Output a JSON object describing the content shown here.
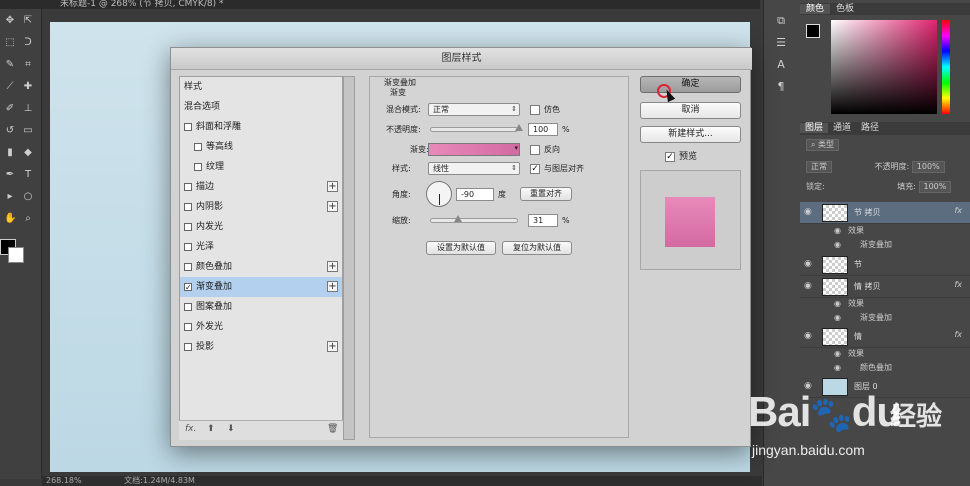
{
  "document_tab": "未标题-1 @ 268% (节 拷贝, CMYK/8) *",
  "status_bar": {
    "zoom": "268.18%",
    "doc_size": "文档:1.24M/4.83M"
  },
  "color_panel": {
    "tabs": [
      "颜色",
      "色板"
    ]
  },
  "layers_panel": {
    "tabs": [
      "图层",
      "通道",
      "路径"
    ],
    "kind_filter": "类型",
    "blend_mode": "正常",
    "opacity_label": "不透明度:",
    "opacity_value": "100%",
    "lock_label": "锁定:",
    "fill_label": "填充:",
    "fill_value": "100%",
    "layers": [
      {
        "name": "节 拷贝",
        "fx": "fx",
        "effects_label": "效果",
        "effect": "渐变叠加"
      },
      {
        "name": "节"
      },
      {
        "name": "情 拷贝",
        "fx": "fx",
        "effects_label": "效果",
        "effect": "渐变叠加"
      },
      {
        "name": "情",
        "fx": "fx",
        "effects_label": "效果",
        "effect": "颜色叠加"
      },
      {
        "name": "图层 0"
      }
    ]
  },
  "dialog": {
    "title": "图层样式",
    "style_list": [
      {
        "label": "样式",
        "checkbox": false,
        "plus": false
      },
      {
        "label": "混合选项",
        "checkbox": false,
        "plus": false
      },
      {
        "label": "斜面和浮雕",
        "checkbox": true,
        "checked": false,
        "plus": false
      },
      {
        "label": "等高线",
        "checkbox": true,
        "checked": false,
        "plus": false
      },
      {
        "label": "纹理",
        "checkbox": true,
        "checked": false,
        "plus": false
      },
      {
        "label": "描边",
        "checkbox": true,
        "checked": false,
        "plus": true
      },
      {
        "label": "内阴影",
        "checkbox": true,
        "checked": false,
        "plus": true
      },
      {
        "label": "内发光",
        "checkbox": true,
        "checked": false,
        "plus": false
      },
      {
        "label": "光泽",
        "checkbox": true,
        "checked": false,
        "plus": false
      },
      {
        "label": "颜色叠加",
        "checkbox": true,
        "checked": false,
        "plus": true
      },
      {
        "label": "渐变叠加",
        "checkbox": true,
        "checked": true,
        "plus": true,
        "selected": true
      },
      {
        "label": "图案叠加",
        "checkbox": true,
        "checked": false,
        "plus": false
      },
      {
        "label": "外发光",
        "checkbox": true,
        "checked": false,
        "plus": false
      },
      {
        "label": "投影",
        "checkbox": true,
        "checked": false,
        "plus": true
      }
    ],
    "footer_fx": "fx.",
    "gradient_overlay": {
      "section_title": "渐变叠加",
      "group_title": "渐变",
      "blend_mode_label": "混合模式:",
      "blend_mode_value": "正常",
      "dither_label": "仿色",
      "dither_checked": false,
      "opacity_label": "不透明度:",
      "opacity_value": "100",
      "opacity_unit": "%",
      "opacity_slider": 1.0,
      "gradient_label": "渐变:",
      "gradient_start_color": "#e78aba",
      "gradient_end_color": "#d36aa2",
      "reverse_label": "反向",
      "reverse_checked": false,
      "style_label": "样式:",
      "style_value": "线性",
      "align_label": "与图层对齐",
      "align_checked": true,
      "angle_label": "角度:",
      "angle_value": "-90",
      "angle_unit": "度",
      "reset_align_button": "重置对齐",
      "scale_label": "缩放:",
      "scale_value": "31",
      "scale_unit": "%",
      "scale_slider": 0.31,
      "set_default_button": "设置为默认值",
      "reset_default_button": "复位为默认值"
    },
    "buttons": {
      "ok": "确定",
      "cancel": "取消",
      "new_style": "新建样式..."
    },
    "preview_label": "预览",
    "preview_checked": true
  },
  "watermark": {
    "brand": "Bai",
    "paw": "du",
    "cn": "经验",
    "url": "jingyan.baidu.com"
  }
}
